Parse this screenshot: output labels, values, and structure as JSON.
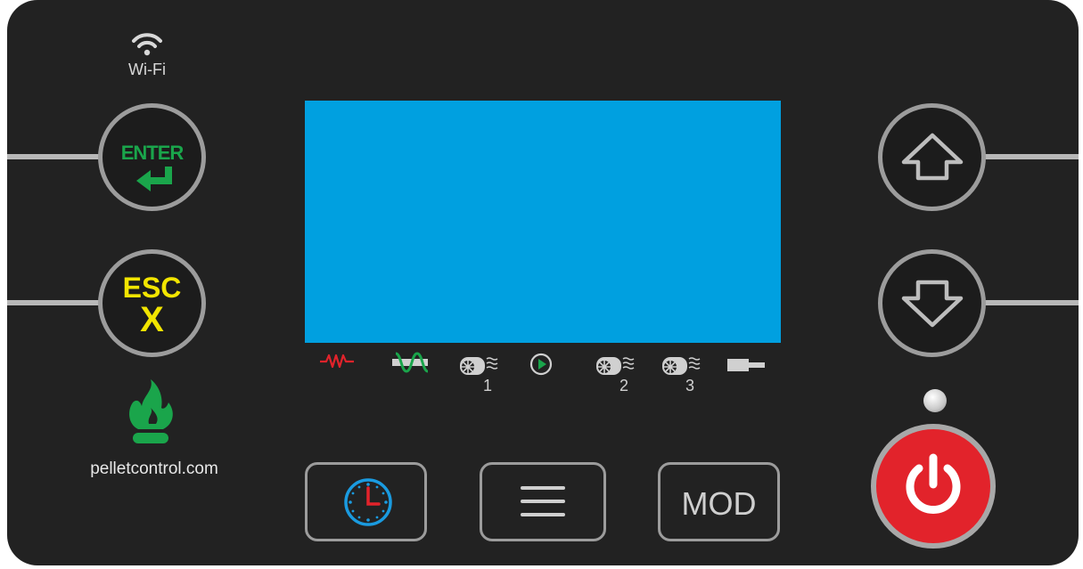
{
  "wifi": {
    "label": "Wi-Fi",
    "icon": "wifi-icon"
  },
  "buttons": {
    "enter": {
      "label": "ENTER",
      "icon": "return-arrow-icon",
      "color": "#1aa54b"
    },
    "esc": {
      "label": "ESC",
      "sublabel": "X",
      "color": "#f2e500"
    },
    "up": {
      "icon": "arrow-up-icon"
    },
    "down": {
      "icon": "arrow-down-icon"
    },
    "clock": {
      "icon": "clock-icon",
      "color": "#1a9be0"
    },
    "menu": {
      "icon": "menu-icon"
    },
    "mod": {
      "label": "MOD"
    },
    "power": {
      "icon": "power-icon",
      "color": "#e2232b"
    }
  },
  "display": {
    "color": "#00a0e0"
  },
  "indicators": [
    {
      "icon": "heater-resistance-icon",
      "color": "#e2232b"
    },
    {
      "icon": "auger-icon",
      "color": "#1aa54b"
    },
    {
      "icon": "fan-1-icon",
      "label": "1"
    },
    {
      "icon": "play-icon",
      "color": "#1aa54b"
    },
    {
      "icon": "fan-2-icon",
      "label": "2"
    },
    {
      "icon": "fan-3-icon",
      "label": "3"
    },
    {
      "icon": "plug-icon"
    }
  ],
  "flame": {
    "icon": "flame-icon",
    "color": "#1aa54b"
  },
  "brand": {
    "url": "pelletcontrol.com"
  },
  "status_led": {
    "icon": "status-led-icon"
  }
}
